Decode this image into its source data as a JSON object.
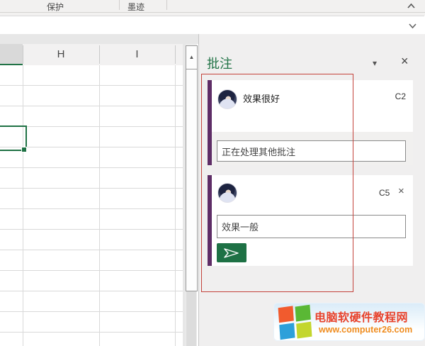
{
  "ribbon": {
    "groups": [
      {
        "label": "保护"
      },
      {
        "label": "墨迹"
      }
    ]
  },
  "formula_bar": {
    "value": ""
  },
  "sheet": {
    "column_headers": [
      "H",
      "I"
    ]
  },
  "comments_panel": {
    "title": "批注",
    "threads": [
      {
        "text": "效果很好",
        "cell_ref": "C2",
        "reply_value": "正在处理其他批注"
      },
      {
        "cell_ref": "C5",
        "draft_text": "效果一般"
      }
    ]
  },
  "watermark": {
    "site_name": "电脑软硬件教程网",
    "site_url": "www.computer26.com"
  },
  "icons": {
    "close": "×",
    "dropdown": "▾",
    "scroll_up": "▲",
    "delete_comment": "×"
  },
  "colors": {
    "excel_green": "#217346",
    "selection_green": "#1f7245",
    "send_button_green": "#1e7145",
    "thread_accent_purple": "#5e2d66",
    "annotation_red": "#c4423b",
    "watermark_title_red": "#e8432d",
    "watermark_url_orange": "#ef8c1e"
  }
}
